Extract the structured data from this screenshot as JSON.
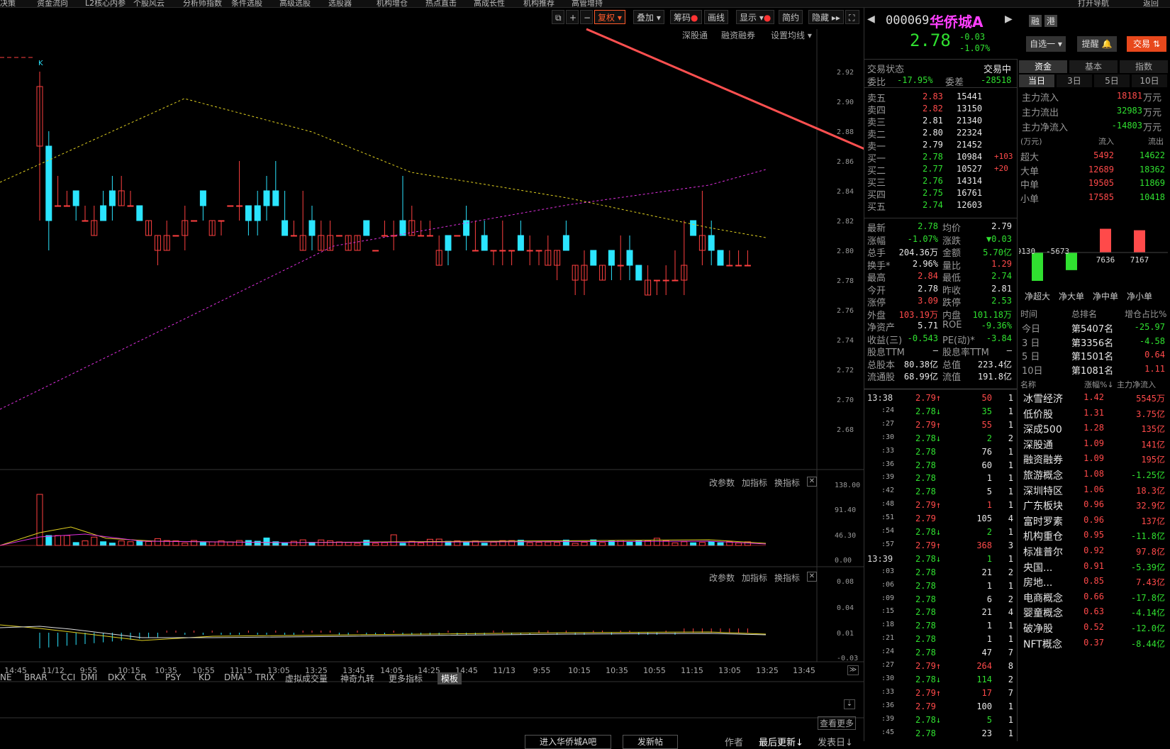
{
  "topmenu": [
    "决策",
    "资金流向",
    "L2核心内参",
    "个股风云",
    "分析师指数",
    "条件选股",
    "高级选股",
    "选股器",
    "机构增仓",
    "热点直击",
    "高成长性",
    "机构推荐",
    "高管增持",
    "打开导航",
    "返回"
  ],
  "toolbar": {
    "fuquan": "复权",
    "diejia": "叠加",
    "chouma": "筹码",
    "huaxian": "画线",
    "xianshi": "显示",
    "jianyue": "简约",
    "yincang": "隐藏"
  },
  "chart_top_links": [
    "深股通",
    "融资融券",
    "设置均线"
  ],
  "price_axis": [
    "2.92",
    "2.90",
    "2.88",
    "2.86",
    "2.84",
    "2.82",
    "2.80",
    "2.78",
    "2.76",
    "2.74",
    "2.72",
    "2.70",
    "2.68"
  ],
  "vol_axis": [
    "138.00",
    "91.40",
    "46.30",
    "0.00"
  ],
  "ind_axis": [
    "0.08",
    "0.04",
    "0.01",
    "-0.03"
  ],
  "panel_links": [
    "改参数",
    "加指标",
    "换指标"
  ],
  "time_axis": [
    "14:45",
    "11/12",
    "9:55",
    "10:15",
    "10:35",
    "10:55",
    "11:15",
    "13:05",
    "13:25",
    "13:45",
    "14:05",
    "14:25",
    "14:45",
    "11/13",
    "9:55",
    "10:15",
    "10:35",
    "10:55",
    "11:15",
    "13:05",
    "13:25",
    "13:45"
  ],
  "indicator_tabs": [
    "NE",
    "BRAR",
    "CCI",
    "DMI",
    "DKX",
    "CR",
    "PSY",
    "KD",
    "DMA",
    "TRIX",
    "虚拟成交量",
    "神奇九转",
    "更多指标",
    "模板"
  ],
  "bottom": {
    "more": "查看更多",
    "forum": "进入华侨城A吧",
    "post": "发新帖",
    "author": "作者",
    "last": "最后更新↓",
    "publish": "发表日↓"
  },
  "chart_data": {
    "type": "candlestick",
    "title": "",
    "xlabel": "",
    "ylabel": "",
    "ylim": [
      2.67,
      2.93
    ]
  },
  "stock": {
    "code": "000069",
    "name": "华侨城A",
    "price": "2.78",
    "change": "-0.03",
    "pct": "-1.07%",
    "rong": "融",
    "gang": "港"
  },
  "right_btns": {
    "zixuan": "自选一",
    "tixing": "提醒",
    "jiaoyi": "交易"
  },
  "status": {
    "label": "交易状态",
    "value": "交易中"
  },
  "webi": {
    "l1": "委比",
    "v1": "-17.95%",
    "l2": "委差",
    "v2": "-28518"
  },
  "asks": [
    {
      "l": "卖五",
      "p": "2.83",
      "v": "15441"
    },
    {
      "l": "卖四",
      "p": "2.82",
      "v": "13150"
    },
    {
      "l": "卖三",
      "p": "2.81",
      "v": "21340"
    },
    {
      "l": "卖二",
      "p": "2.80",
      "v": "22324"
    },
    {
      "l": "卖一",
      "p": "2.79",
      "v": "21452"
    }
  ],
  "bids": [
    {
      "l": "买一",
      "p": "2.78",
      "v": "10984",
      "d": "+103"
    },
    {
      "l": "买二",
      "p": "2.77",
      "v": "10527",
      "d": "+20"
    },
    {
      "l": "买三",
      "p": "2.76",
      "v": "14314",
      "d": ""
    },
    {
      "l": "买四",
      "p": "2.75",
      "v": "16761",
      "d": ""
    },
    {
      "l": "买五",
      "p": "2.74",
      "v": "12603",
      "d": ""
    }
  ],
  "quote": [
    [
      "最新",
      "2.78",
      "均价",
      "2.79"
    ],
    [
      "涨幅",
      "-1.07%",
      "涨跌",
      "▼0.03"
    ],
    [
      "总手",
      "204.36万",
      "金额",
      "5.70亿"
    ],
    [
      "换手*",
      "2.96%",
      "量比",
      "1.29"
    ],
    [
      "最高",
      "2.84",
      "最低",
      "2.74"
    ],
    [
      "今开",
      "2.78",
      "昨收",
      "2.81"
    ],
    [
      "涨停",
      "3.09",
      "跌停",
      "2.53"
    ],
    [
      "外盘",
      "103.19万",
      "内盘",
      "101.18万"
    ],
    [
      "净资产",
      "5.71",
      "ROE",
      "-9.36%"
    ],
    [
      "收益(三)",
      "-0.543",
      "PE(动)*",
      "-3.84"
    ],
    [
      "股息TTM",
      "—",
      "股息率TTM",
      "—"
    ],
    [
      "总股本",
      "80.38亿",
      "总值",
      "223.4亿"
    ],
    [
      "流通股",
      "68.99亿",
      "流值",
      "191.8亿"
    ]
  ],
  "ticks": [
    [
      "13:38",
      "2.79↑",
      "50",
      "1"
    ],
    [
      ":24",
      "2.78↓",
      "35",
      "1"
    ],
    [
      ":27",
      "2.79↑",
      "55",
      "1"
    ],
    [
      ":30",
      "2.78↓",
      "2",
      "2"
    ],
    [
      ":33",
      "2.78",
      "76",
      "1"
    ],
    [
      ":36",
      "2.78",
      "60",
      "1"
    ],
    [
      ":39",
      "2.78",
      "1",
      "1"
    ],
    [
      ":42",
      "2.78",
      "5",
      "1"
    ],
    [
      ":48",
      "2.79↑",
      "1",
      "1"
    ],
    [
      ":51",
      "2.79",
      "105",
      "4"
    ],
    [
      ":54",
      "2.78↓",
      "2",
      "1"
    ],
    [
      ":57",
      "2.79↑",
      "368",
      "3"
    ],
    [
      "13:39",
      "2.78↓",
      "1",
      "1"
    ],
    [
      ":03",
      "2.78",
      "21",
      "2"
    ],
    [
      ":06",
      "2.78",
      "1",
      "1"
    ],
    [
      ":09",
      "2.78",
      "6",
      "2"
    ],
    [
      ":15",
      "2.78",
      "21",
      "4"
    ],
    [
      ":18",
      "2.78",
      "1",
      "1"
    ],
    [
      ":21",
      "2.78",
      "1",
      "1"
    ],
    [
      ":24",
      "2.78",
      "47",
      "7"
    ],
    [
      ":27",
      "2.79↑",
      "264",
      "8"
    ],
    [
      ":30",
      "2.78↓",
      "114",
      "2"
    ],
    [
      ":33",
      "2.79↑",
      "17",
      "7"
    ],
    [
      ":36",
      "2.79",
      "100",
      "1"
    ],
    [
      ":39",
      "2.78↓",
      "5",
      "1"
    ],
    [
      ":45",
      "2.78",
      "23",
      "1"
    ]
  ],
  "fund_tabs": [
    "资金",
    "基本",
    "指数"
  ],
  "period_tabs": [
    "当日",
    "3日",
    "5日",
    "10日"
  ],
  "flow": [
    [
      "主力流入",
      "18181",
      "万元"
    ],
    [
      "主力流出",
      "32983",
      "万元"
    ],
    [
      "主力净流入",
      "-14803",
      "万元"
    ]
  ],
  "flow_head": [
    "(万元)",
    "流入",
    "流出"
  ],
  "flow_table": [
    [
      "超大",
      "5492",
      "14622"
    ],
    [
      "大单",
      "12689",
      "18362"
    ],
    [
      "中单",
      "19505",
      "11869"
    ],
    [
      "小单",
      "17585",
      "10418"
    ]
  ],
  "net_bars": {
    "labels": [
      "净超大",
      "净大单",
      "净中单",
      "净小单"
    ],
    "values": [
      -9130,
      -5673,
      7636,
      7167
    ]
  },
  "rank_head": [
    "时间",
    "总排名",
    "增仓占比%"
  ],
  "rank": [
    [
      "今日",
      "第5407名",
      "-25.97"
    ],
    [
      "3 日",
      "第3356名",
      "-4.58"
    ],
    [
      "5 日",
      "第1501名",
      "0.64"
    ],
    [
      "10日",
      "第1081名",
      "1.11"
    ]
  ],
  "sector_head": [
    "名称",
    "涨幅%↓",
    "主力净流入"
  ],
  "sectors": [
    [
      "冰雪经济",
      "1.42",
      "5545万"
    ],
    [
      "低价股",
      "1.31",
      "3.75亿"
    ],
    [
      "深成500",
      "1.28",
      "135亿"
    ],
    [
      "深股通",
      "1.09",
      "141亿"
    ],
    [
      "融资融券",
      "1.09",
      "195亿"
    ],
    [
      "旅游概念",
      "1.08",
      "-1.25亿"
    ],
    [
      "深圳特区",
      "1.06",
      "18.3亿"
    ],
    [
      "广东板块",
      "0.96",
      "32.9亿"
    ],
    [
      "富时罗素",
      "0.96",
      "137亿"
    ],
    [
      "机构重仓",
      "0.95",
      "-11.8亿"
    ],
    [
      "标准普尔",
      "0.92",
      "97.8亿"
    ],
    [
      "央国...",
      "0.91",
      "-5.39亿"
    ],
    [
      "房地...",
      "0.85",
      "7.43亿"
    ],
    [
      "电商概念",
      "0.66",
      "-17.8亿"
    ],
    [
      "婴童概念",
      "0.63",
      "-4.14亿"
    ],
    [
      "破净股",
      "0.52",
      "-12.0亿"
    ],
    [
      "NFT概念",
      "0.37",
      "-8.44亿"
    ]
  ]
}
